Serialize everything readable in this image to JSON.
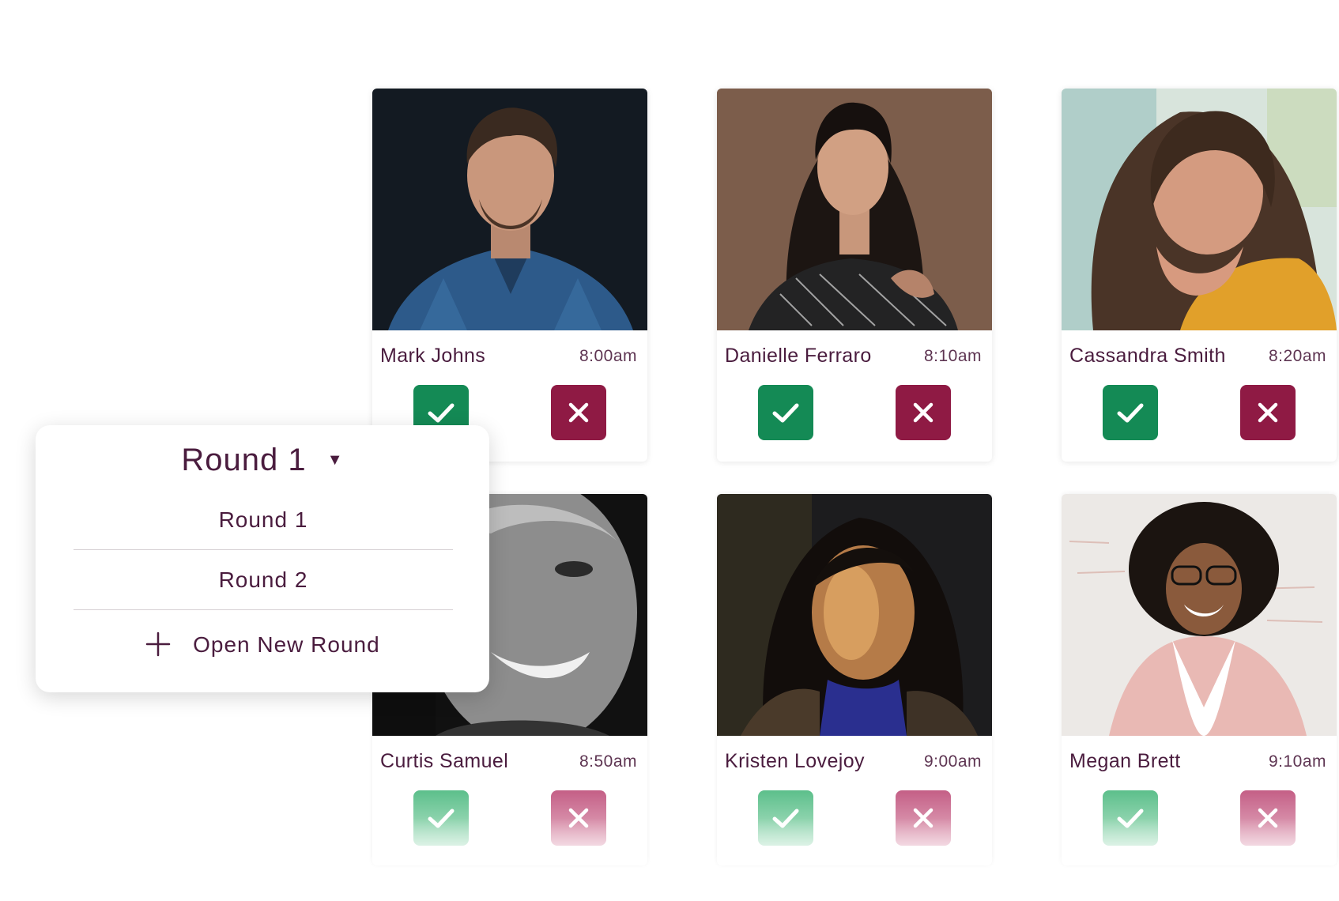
{
  "candidates": [
    {
      "name": "Mark Johns",
      "time": "8:00am",
      "photo": "portrait-man-blue-plaid-shirt"
    },
    {
      "name": "Danielle Ferraro",
      "time": "8:10am",
      "photo": "portrait-woman-dark-hair-black-top"
    },
    {
      "name": "Cassandra Smith",
      "time": "8:20am",
      "photo": "portrait-woman-yellow-sweater"
    },
    {
      "name": "Curtis Samuel",
      "time": "8:50am",
      "photo": "portrait-man-black-and-white-smiling"
    },
    {
      "name": "Kristen Lovejoy",
      "time": "9:00am",
      "photo": "portrait-woman-sunlit-face"
    },
    {
      "name": "Megan Brett",
      "time": "9:10am",
      "photo": "portrait-woman-curly-hair-glasses"
    }
  ],
  "round_dropdown": {
    "selected": "Round 1",
    "options": [
      "Round 1",
      "Round 2"
    ],
    "new_round_label": "Open New Round"
  },
  "icons": {
    "approve": "checkmark-icon",
    "reject": "close-icon",
    "dropdown": "caret-down-icon",
    "new": "plus-icon"
  },
  "colors": {
    "approve": "#148a55",
    "reject": "#8f1a44",
    "text": "#4a1c3e"
  }
}
